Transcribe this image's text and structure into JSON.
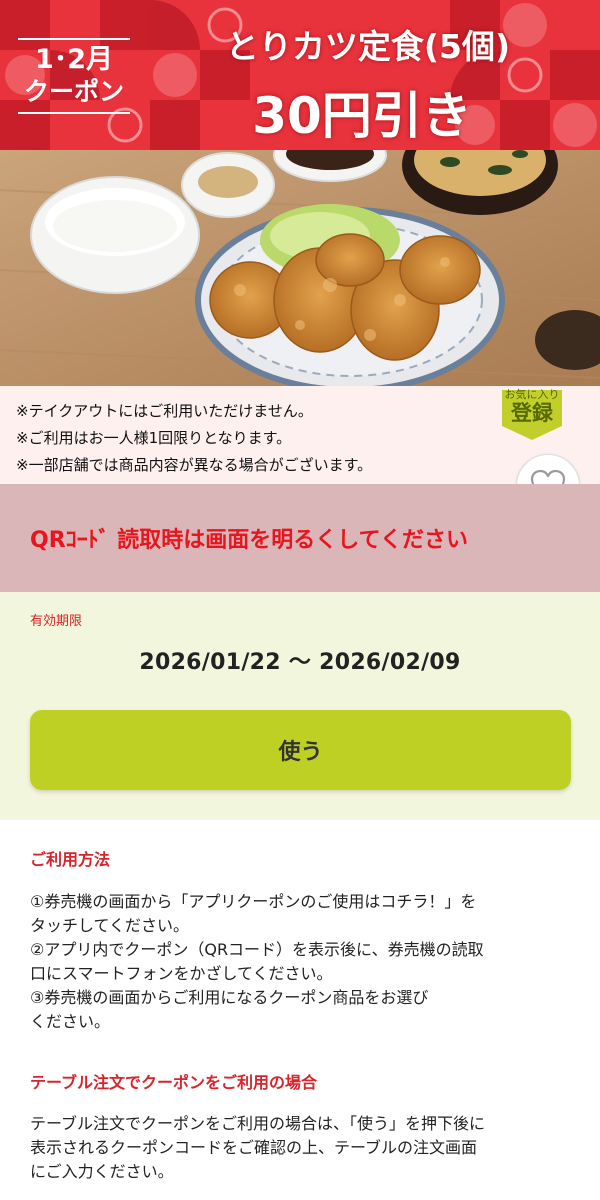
{
  "banner": {
    "badge_line1": "1･2月",
    "badge_line2": "クーポン",
    "title": "とりカツ定食(5個)",
    "discount": "30円引き",
    "colors": {
      "red": "#e8323c",
      "pattern": "#c81f2b",
      "pink": "#f48a8f"
    }
  },
  "notices": [
    "※テイクアウトにはご利用いただけません。",
    "※ご利用はお一人様1回限りとなります。",
    "※一部店舗では商品内容が異なる場合がございます。"
  ],
  "favorite": {
    "top_label": "お気に入り",
    "main_label": "登録",
    "icon": "heart-outline-icon"
  },
  "qr_notice": "QRｺｰﾄﾞ 読取時は画面を明るくしてください",
  "validity": {
    "label": "有効期限",
    "range": "2026/01/22 〜 2026/02/09"
  },
  "use_button_label": "使う",
  "how_to_use": {
    "heading": "ご利用方法",
    "steps": [
      "①券売機の画面から「アプリクーポンのご使用はコチラ！」を",
      "タッチしてください。",
      "②アプリ内でクーポン（QRコード）を表示後に、券売機の読取",
      "口にスマートフォンをかざしてください。",
      "③券売機の画面からご利用になるクーポン商品をお選び",
      "ください。"
    ]
  },
  "table_order": {
    "heading": "テーブル注文でクーポンをご利用の場合",
    "lines": [
      "テーブル注文でクーポンをご利用の場合は、「使う」を押下後に",
      "表示されるクーポンコードをご確認の上、テーブルの注文画面",
      "にご入力ください。"
    ]
  },
  "colors": {
    "accent_red": "#d9242b",
    "qr_red": "#e8141e",
    "button_green": "#bfd024",
    "validity_bg": "#f2f6dc",
    "qr_bg": "#dbb6b8",
    "notice_bg": "#fdf0ef"
  }
}
